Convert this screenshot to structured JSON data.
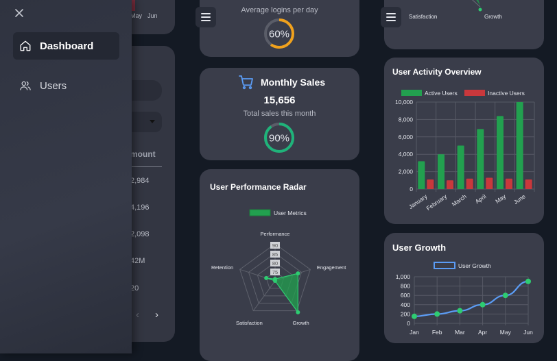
{
  "sidebar": {
    "items": [
      {
        "label": "Dashboard",
        "icon": "home-icon",
        "active": true
      },
      {
        "label": "Users",
        "icon": "users-icon",
        "active": false
      }
    ]
  },
  "background_panel": {
    "month_labels": [
      "May",
      "Jun"
    ],
    "column_header": "mount",
    "amounts": [
      "2,984",
      "4,196",
      "2,098",
      "42M",
      "20"
    ]
  },
  "logins_card": {
    "subtitle": "Average logins per day",
    "percent": 60,
    "percent_label": "60%",
    "ring_color": "#f0a11c"
  },
  "sales_card": {
    "title": "Monthly Sales",
    "value": "15,656",
    "subtitle": "Total sales this month",
    "percent": 90,
    "percent_label": "90%",
    "ring_color": "#1fb37a",
    "icon": "cart-icon"
  },
  "top_radar_fragment": {
    "labels": [
      "Satisfaction",
      "Growth"
    ]
  },
  "radar_card": {
    "title": "User Performance Radar",
    "chart_data": {
      "type": "radar",
      "categories": [
        "Performance",
        "Engagement",
        "Growth",
        "Satisfaction",
        "Retention"
      ],
      "series": [
        {
          "name": "User Metrics",
          "values": [
            76,
            88,
            96,
            75,
            80
          ],
          "color": "#22a04f"
        }
      ],
      "ticks": [
        "90",
        "85",
        "80",
        "75"
      ],
      "range": [
        75,
        95
      ],
      "legend": "top"
    }
  },
  "activity_card": {
    "title": "User Activity Overview",
    "chart_data": {
      "type": "bar",
      "categories": [
        "January",
        "February",
        "March",
        "April",
        "May",
        "June"
      ],
      "series": [
        {
          "name": "Active Users",
          "values": [
            3200,
            4000,
            5000,
            6900,
            8400,
            10000
          ],
          "color": "#22a04f"
        },
        {
          "name": "Inactive Users",
          "values": [
            1100,
            1000,
            1200,
            1300,
            1200,
            1100
          ],
          "color": "#c9383c"
        }
      ],
      "ylim": [
        0,
        10000
      ],
      "yticks": [
        "0",
        "2,000",
        "4,000",
        "6,000",
        "8,000",
        "10,000"
      ],
      "grid": true,
      "legend": "top"
    }
  },
  "growth_card": {
    "title": "User Growth",
    "chart_data": {
      "type": "line",
      "categories": [
        "Jan",
        "Feb",
        "Mar",
        "Apr",
        "May",
        "Jun"
      ],
      "series": [
        {
          "name": "User Growth",
          "values": [
            150,
            200,
            270,
            400,
            600,
            900
          ],
          "color": "#5b9cf5"
        }
      ],
      "ylim": [
        0,
        1000
      ],
      "yticks": [
        "0",
        "200",
        "400",
        "600",
        "800",
        "1,000"
      ],
      "grid": true,
      "legend": "top"
    }
  }
}
